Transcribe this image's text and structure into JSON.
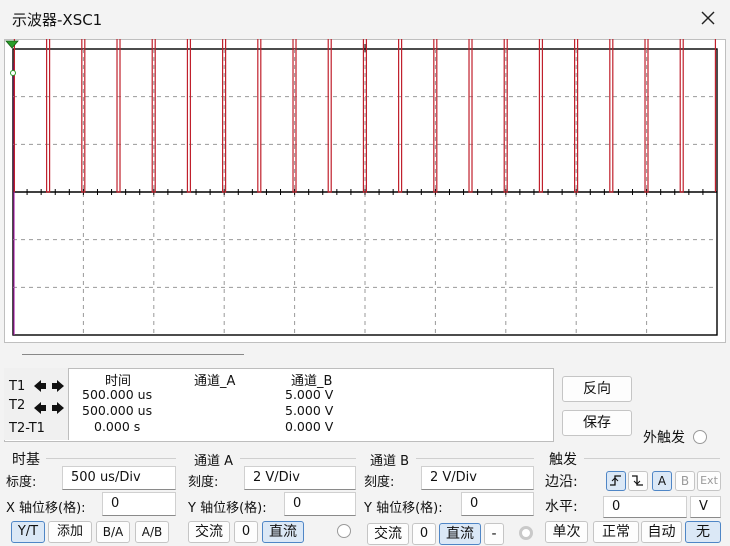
{
  "window": {
    "title": "示波器-XSC1"
  },
  "icons": {
    "close": "close-icon",
    "left": "arrow-left-icon",
    "right": "arrow-right-icon",
    "rise": "rising-edge-icon",
    "fall": "falling-edge-icon"
  },
  "colors": {
    "trace_a": "#c0202c",
    "trace_b": "#000000",
    "grid": "#9a9a9a",
    "marker": "#2a9d2a"
  },
  "cursors": {
    "t1_label": "T1",
    "t2_label": "T2",
    "diff_label": "T2-T1",
    "headers": {
      "time": "时间",
      "channel_a": "通道_A",
      "channel_b": "通道_B"
    },
    "rows": [
      {
        "time": "500.000 us",
        "channel_a": "",
        "channel_b": "5.000 V"
      },
      {
        "time": "500.000 us",
        "channel_a": "",
        "channel_b": "5.000 V"
      },
      {
        "time": "0.000 s",
        "channel_a": "",
        "channel_b": "0.000 V"
      }
    ]
  },
  "actions": {
    "reverse": "反向",
    "save": "保存",
    "ext_trigger": "外触发"
  },
  "timebase": {
    "title": "时基",
    "scale_label": "标度:",
    "scale_value": "500 us/Div",
    "xpos_label": "X 轴位移(格):",
    "xpos_value": "0",
    "modes": [
      "Y/T",
      "添加",
      "B/A",
      "A/B"
    ]
  },
  "channel_a": {
    "title": "通道 A",
    "scale_label": "刻度:",
    "scale_value": "2  V/Div",
    "ypos_label": "Y 轴位移(格):",
    "ypos_value": "0",
    "coupling": [
      "交流",
      "0",
      "直流"
    ]
  },
  "channel_b": {
    "title": "通道 B",
    "scale_label": "刻度:",
    "scale_value": "2  V/Div",
    "ypos_label": "Y 轴位移(格):",
    "ypos_value": "0",
    "coupling": [
      "交流",
      "0",
      "直流",
      "-"
    ]
  },
  "trigger": {
    "title": "触发",
    "edge_label": "边沿:",
    "level_label": "水平:",
    "level_value": "0",
    "level_unit": "V",
    "sources": [
      "A",
      "B",
      "Ext"
    ],
    "modes": [
      "单次",
      "正常",
      "自动",
      "无"
    ]
  },
  "chart_data": {
    "type": "line",
    "series": [
      {
        "period_div": 0.5,
        "high_fraction": 0.915,
        "high_v": 5,
        "low_v": 0,
        "first_rise_div": 0.02,
        "total_div": 10
      },
      {
        "constant_v": 0
      }
    ],
    "xlim": [
      0,
      10
    ],
    "ylim": [
      -4,
      4
    ],
    "grid": true,
    "y_divisions": 6
  }
}
